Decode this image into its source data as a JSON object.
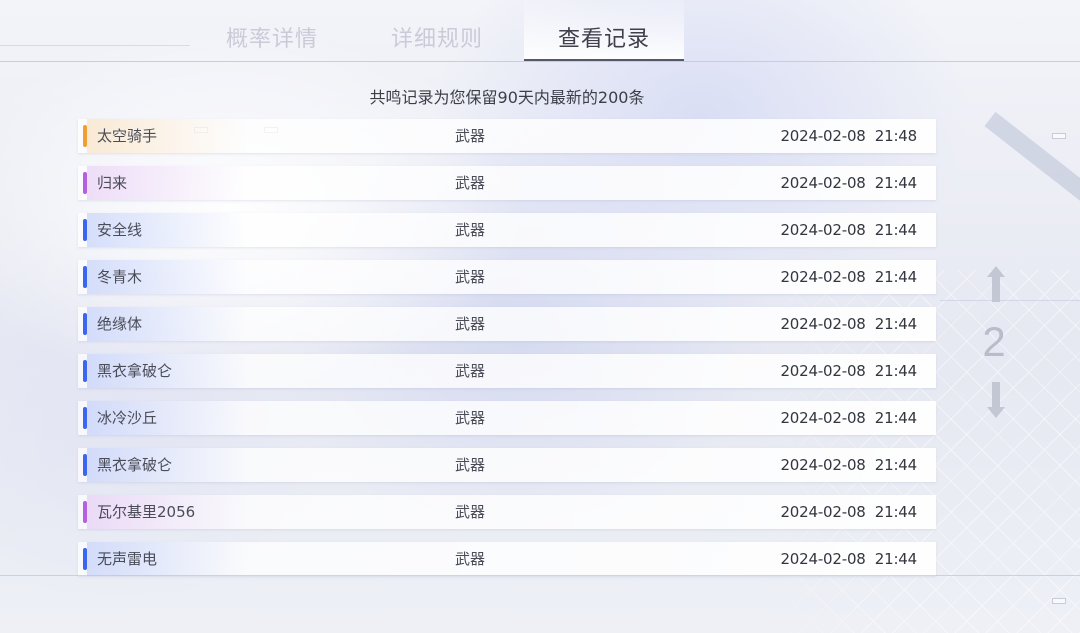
{
  "tabs": [
    {
      "label": "概率详情",
      "active": false
    },
    {
      "label": "详细规则",
      "active": false
    },
    {
      "label": "查看记录",
      "active": true
    }
  ],
  "notice": "共鸣记录为您保留90天内最新的200条",
  "records": [
    {
      "name": "太空骑手",
      "type": "武器",
      "time": "2024-02-08  21:48",
      "rarity_color": "#f0a033"
    },
    {
      "name": "归来",
      "type": "武器",
      "time": "2024-02-08  21:44",
      "rarity_color": "#b460e0"
    },
    {
      "name": "安全线",
      "type": "武器",
      "time": "2024-02-08  21:44",
      "rarity_color": "#3a66f0"
    },
    {
      "name": "冬青木",
      "type": "武器",
      "time": "2024-02-08  21:44",
      "rarity_color": "#3a66f0"
    },
    {
      "name": "绝缘体",
      "type": "武器",
      "time": "2024-02-08  21:44",
      "rarity_color": "#3a66f0"
    },
    {
      "name": "黑衣拿破仑",
      "type": "武器",
      "time": "2024-02-08  21:44",
      "rarity_color": "#3a66f0"
    },
    {
      "name": "冰冷沙丘",
      "type": "武器",
      "time": "2024-02-08  21:44",
      "rarity_color": "#3a66f0"
    },
    {
      "name": "黑衣拿破仑",
      "type": "武器",
      "time": "2024-02-08  21:44",
      "rarity_color": "#3a66f0"
    },
    {
      "name": "瓦尔基里2056",
      "type": "武器",
      "time": "2024-02-08  21:44",
      "rarity_color": "#b460e0"
    },
    {
      "name": "无声雷电",
      "type": "武器",
      "time": "2024-02-08  21:44",
      "rarity_color": "#3a66f0"
    }
  ],
  "pager": {
    "current_page": "2",
    "up_icon": "arrow-up-icon",
    "down_icon": "arrow-down-icon"
  }
}
